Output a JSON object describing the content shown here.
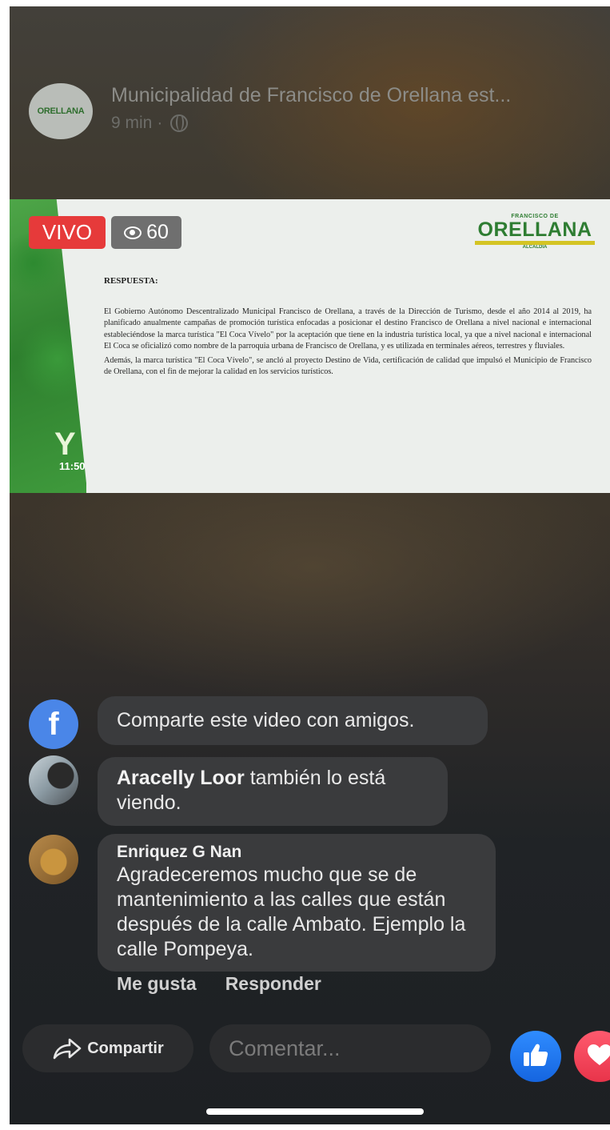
{
  "header": {
    "page_name": "Municipalidad de Francisco de Orellana est...",
    "time_ago": "9 min",
    "separator": "·",
    "avatar_logo_text": "ORELLANA"
  },
  "video": {
    "live_label": "VIVO",
    "viewers": "60",
    "clock": "11:50",
    "corner_logo": "Y",
    "brand": {
      "top": "FRANCISCO DE",
      "main": "ORELLANA",
      "sub": "ALCALDÍA"
    },
    "document": {
      "heading": "RESPUESTA:",
      "paragraph_1": "El Gobierno Autónomo Descentralizado Municipal Francisco de Orellana, a través de la Dirección de Turismo, desde el año 2014 al 2019, ha planificado anualmente campañas de promoción turística enfocadas a posicionar el destino Francisco de Orellana a nivel nacional e internacional estableciéndose la marca turística \"El Coca Vívelo\" por la aceptación que tiene en la industria turística local, ya que a nivel nacional e internacional El Coca se oficializó como nombre de la parroquia urbana de Francisco de Orellana, y es utilizada en terminales aéreos, terrestres y fluviales.",
      "paragraph_2": "Además, la marca turística \"El Coca Vívelo\", se ancló al proyecto Destino de Vida, certificación de calidad que impulsó el Municipio de Francisco de Orellana, con el fin de mejorar la calidad en los servicios turísticos."
    }
  },
  "comments": {
    "share_prompt": "Comparte este video con amigos.",
    "share_prompt_icon": "f",
    "viewer_name": "Aracelly Loor",
    "viewer_text": " también lo está viendo.",
    "comment_author": "Enriquez G Nan",
    "comment_text": "Agradeceremos mucho que se de mantenimiento a las calles que están después de la calle Ambato. Ejemplo la calle Pompeya.",
    "like_action": "Me gusta",
    "reply_action": "Responder"
  },
  "bottom_bar": {
    "share_label": "Compartir",
    "comment_placeholder": "Comentar..."
  },
  "colors": {
    "live_red": "#e63a3a",
    "like_blue": "#1877f2",
    "love_red": "#f0445a",
    "brand_green": "#2e7d32"
  }
}
